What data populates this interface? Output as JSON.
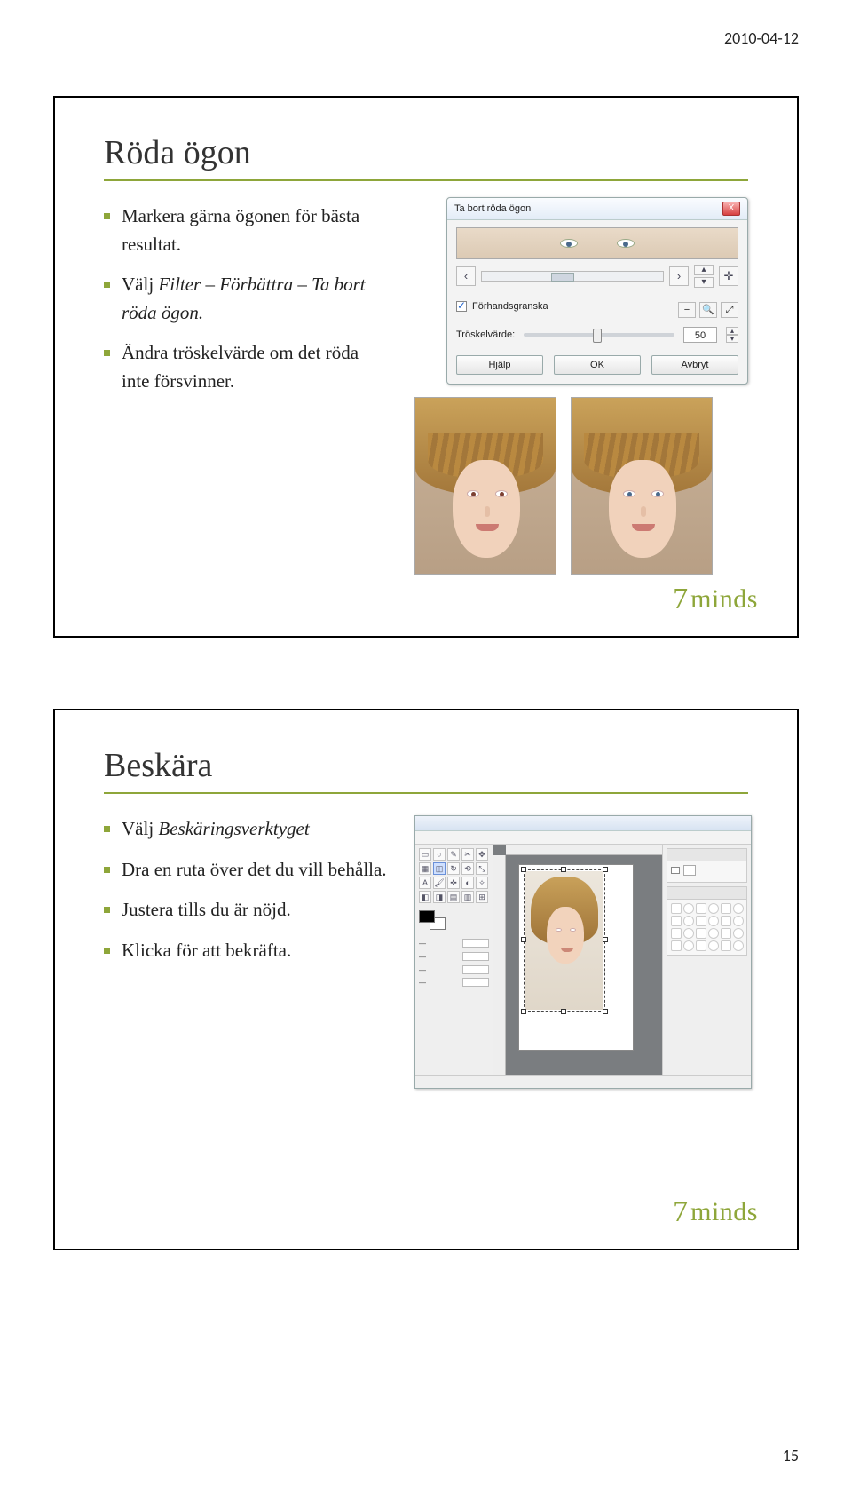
{
  "header": {
    "date": "2010-04-12"
  },
  "footer": {
    "pagenum": "15"
  },
  "logo": {
    "seven": "7",
    "word": "minds"
  },
  "slide1": {
    "title": "Röda ögon",
    "bullets": {
      "b1a": "Markera gärna ögonen för bästa resultat.",
      "b2a": "Välj ",
      "b2b": "Filter – Förbättra – Ta bort röda ögon.",
      "b3a": "Ändra tröskelvärde om det röda inte försvinner."
    },
    "dialog": {
      "title": "Ta bort röda ögon",
      "close": "X",
      "preview_label": "Förhandsgranska",
      "threshold_label": "Tröskelvärde:",
      "threshold_value": "50",
      "btn_help": "Hjälp",
      "btn_ok": "OK",
      "btn_cancel": "Avbryt"
    }
  },
  "slide2": {
    "title": "Beskära",
    "bullets": {
      "b1a": "Välj ",
      "b1b": "Beskäringsverktyget",
      "b2a": "Dra en ruta över det du vill behålla.",
      "b3a": "Justera tills du är nöjd.",
      "b4a": "Klicka för att bekräfta."
    }
  }
}
